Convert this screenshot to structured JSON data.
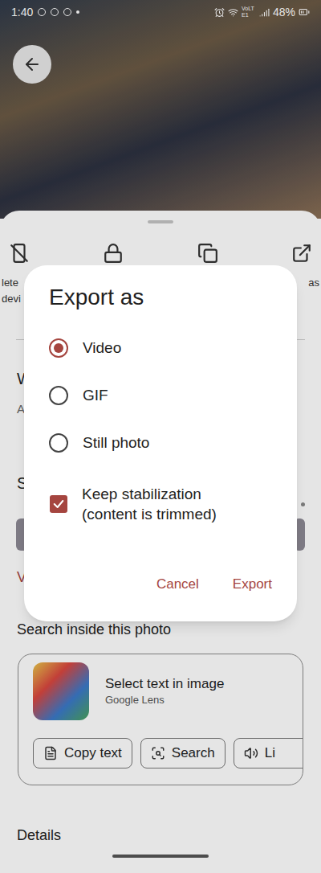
{
  "status_bar": {
    "time": "1:40",
    "network": "VoLTE1",
    "battery": "48%"
  },
  "sheet": {
    "action_labels": {
      "left": [
        "lete",
        "devi"
      ],
      "right": [
        "as"
      ]
    },
    "partial_texts": {
      "heading_1": "W",
      "line_1": "A",
      "heading_2": "S",
      "link": "V"
    },
    "lens_section": {
      "heading": "Search inside this photo",
      "title": "Select text in image",
      "subtitle": "Google Lens",
      "chips": [
        {
          "label": "Copy text",
          "kind": "copy"
        },
        {
          "label": "Search",
          "kind": "search"
        },
        {
          "label": "Li",
          "kind": "listen"
        }
      ]
    },
    "details_heading": "Details"
  },
  "dialog": {
    "title": "Export as",
    "options": [
      {
        "label": "Video",
        "selected": true
      },
      {
        "label": "GIF",
        "selected": false
      },
      {
        "label": "Still photo",
        "selected": false
      }
    ],
    "stabilization": {
      "label": "Keep stabilization (content is trimmed)",
      "checked": true
    },
    "buttons": [
      "Cancel",
      "Export"
    ]
  }
}
